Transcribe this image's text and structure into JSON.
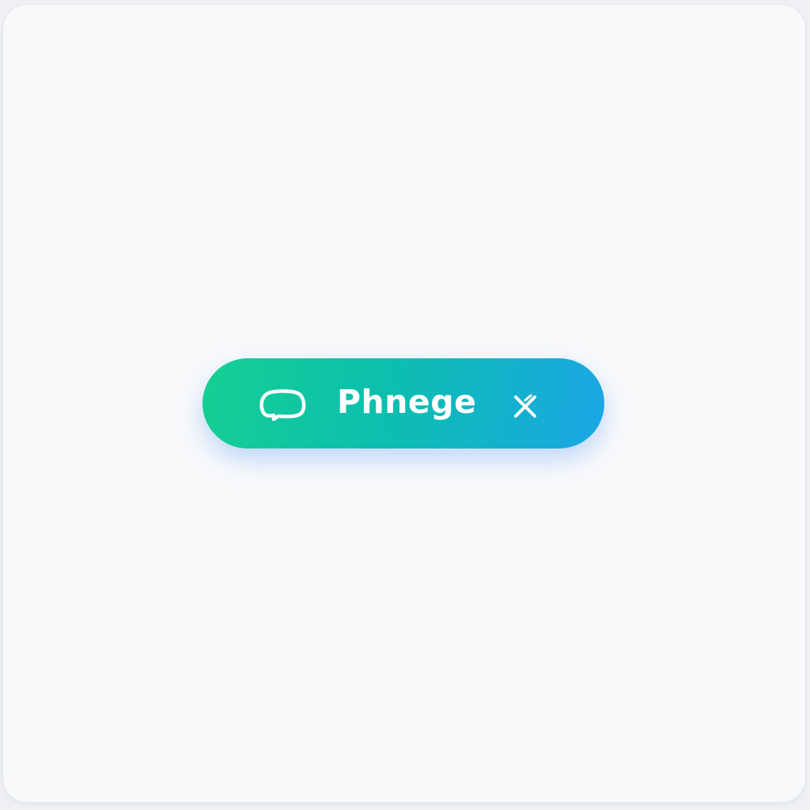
{
  "chip": {
    "label": "Phnege",
    "leading_icon": "chat-bubble-icon",
    "trailing_icon": "close-icon"
  },
  "colors": {
    "page_background": "#f8f9fb",
    "gradient_start": "#15cf92",
    "gradient_end": "#1ba6e6",
    "text": "#ffffff"
  }
}
